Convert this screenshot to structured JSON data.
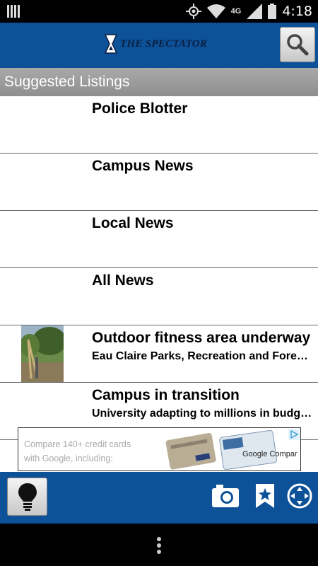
{
  "status_bar": {
    "time": "4:18",
    "network": "4G",
    "icons": [
      "notification-icon",
      "gps-icon",
      "wifi-icon",
      "signal-icon",
      "battery-icon"
    ]
  },
  "header": {
    "logo_text": "THE SPECTATOR",
    "search_icon": "search-icon"
  },
  "section": {
    "title": "Suggested Listings"
  },
  "listings": [
    {
      "title": "Police Blotter",
      "subtitle": ""
    },
    {
      "title": "Campus News",
      "subtitle": ""
    },
    {
      "title": "Local News",
      "subtitle": ""
    },
    {
      "title": "All News",
      "subtitle": ""
    },
    {
      "title": "Outdoor fitness area underway",
      "subtitle": "Eau Claire Parks, Recreation and Forestry Department"
    },
    {
      "title": "Campus in transition",
      "subtitle": "University adapting to millions in budget cuts"
    }
  ],
  "ad": {
    "line1": "Compare 140+ credit cards",
    "line2": "with Google, including:",
    "brand": "Google Compare"
  },
  "toolbar": {
    "icons": [
      "lightbulb-icon",
      "camera-icon",
      "bookmark-star-icon",
      "navigation-icon"
    ]
  },
  "colors": {
    "brand_blue": "#0d5199",
    "section_gray": "#999999"
  }
}
